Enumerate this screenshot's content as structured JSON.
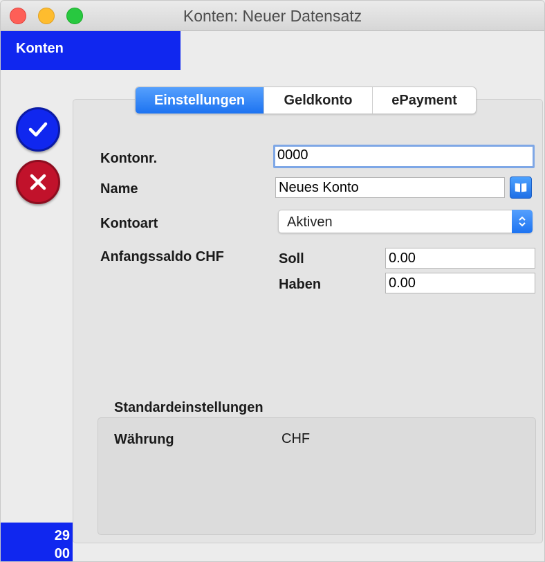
{
  "window": {
    "title": "Konten: Neuer Datensatz"
  },
  "module": {
    "title": "Konten"
  },
  "sidebar": {
    "ok_icon": "checkmark-icon",
    "cancel_icon": "close-x-icon",
    "counter_line1": "29",
    "counter_line2": "00"
  },
  "tabs": [
    {
      "label": "Einstellungen",
      "active": true
    },
    {
      "label": "Geldkonto",
      "active": false
    },
    {
      "label": "ePayment",
      "active": false
    }
  ],
  "form": {
    "kontonr_label": "Kontonr.",
    "kontonr_value": "0000",
    "name_label": "Name",
    "name_value": "Neues Konto",
    "kontoart_label": "Kontoart",
    "kontoart_value": "Aktiven",
    "anfangssaldo_label": "Anfangssaldo CHF",
    "soll_label": "Soll",
    "soll_value": "0.00",
    "haben_label": "Haben",
    "haben_value": "0.00"
  },
  "standard": {
    "title": "Standardeinstellungen",
    "waehrung_label": "Währung",
    "waehrung_value": "CHF"
  },
  "colors": {
    "brand_blue": "#1027ef",
    "cancel_red": "#c1122b",
    "accent_blue": "#1d73f1"
  }
}
